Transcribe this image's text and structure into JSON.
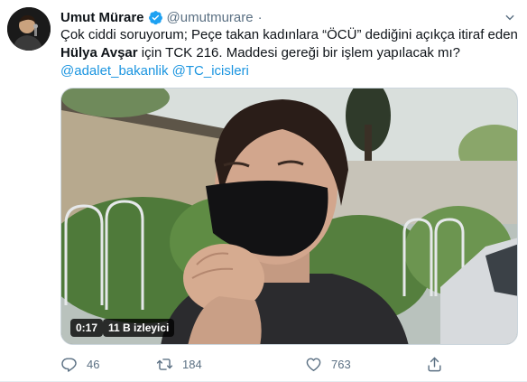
{
  "tweet": {
    "display_name": "Umut Mürare",
    "handle": "@umutmurare",
    "separator": "·",
    "more_icon": "ellipsis-icon",
    "text": {
      "line1": "Çok ciddi soruyorum; Peçe takan kadınlara “ÖCÜ” dediğini açıkça itiraf eden",
      "name_bold": "Hülya Avşar",
      "line2_rest": " için TCK 216. Maddesi gereği bir işlem yapılacak mı?",
      "mention1": "@adalet_bakanlik",
      "mention2": "@TC_icisleri"
    },
    "media": {
      "duration": "0:17",
      "views": "11 B izleyici"
    },
    "actions": {
      "reply_count": "46",
      "retweet_count": "184",
      "like_count": "763"
    }
  },
  "colors": {
    "accent": "#1b95e0",
    "verified": "#1da1f2",
    "secondary_text": "#5b7083"
  }
}
